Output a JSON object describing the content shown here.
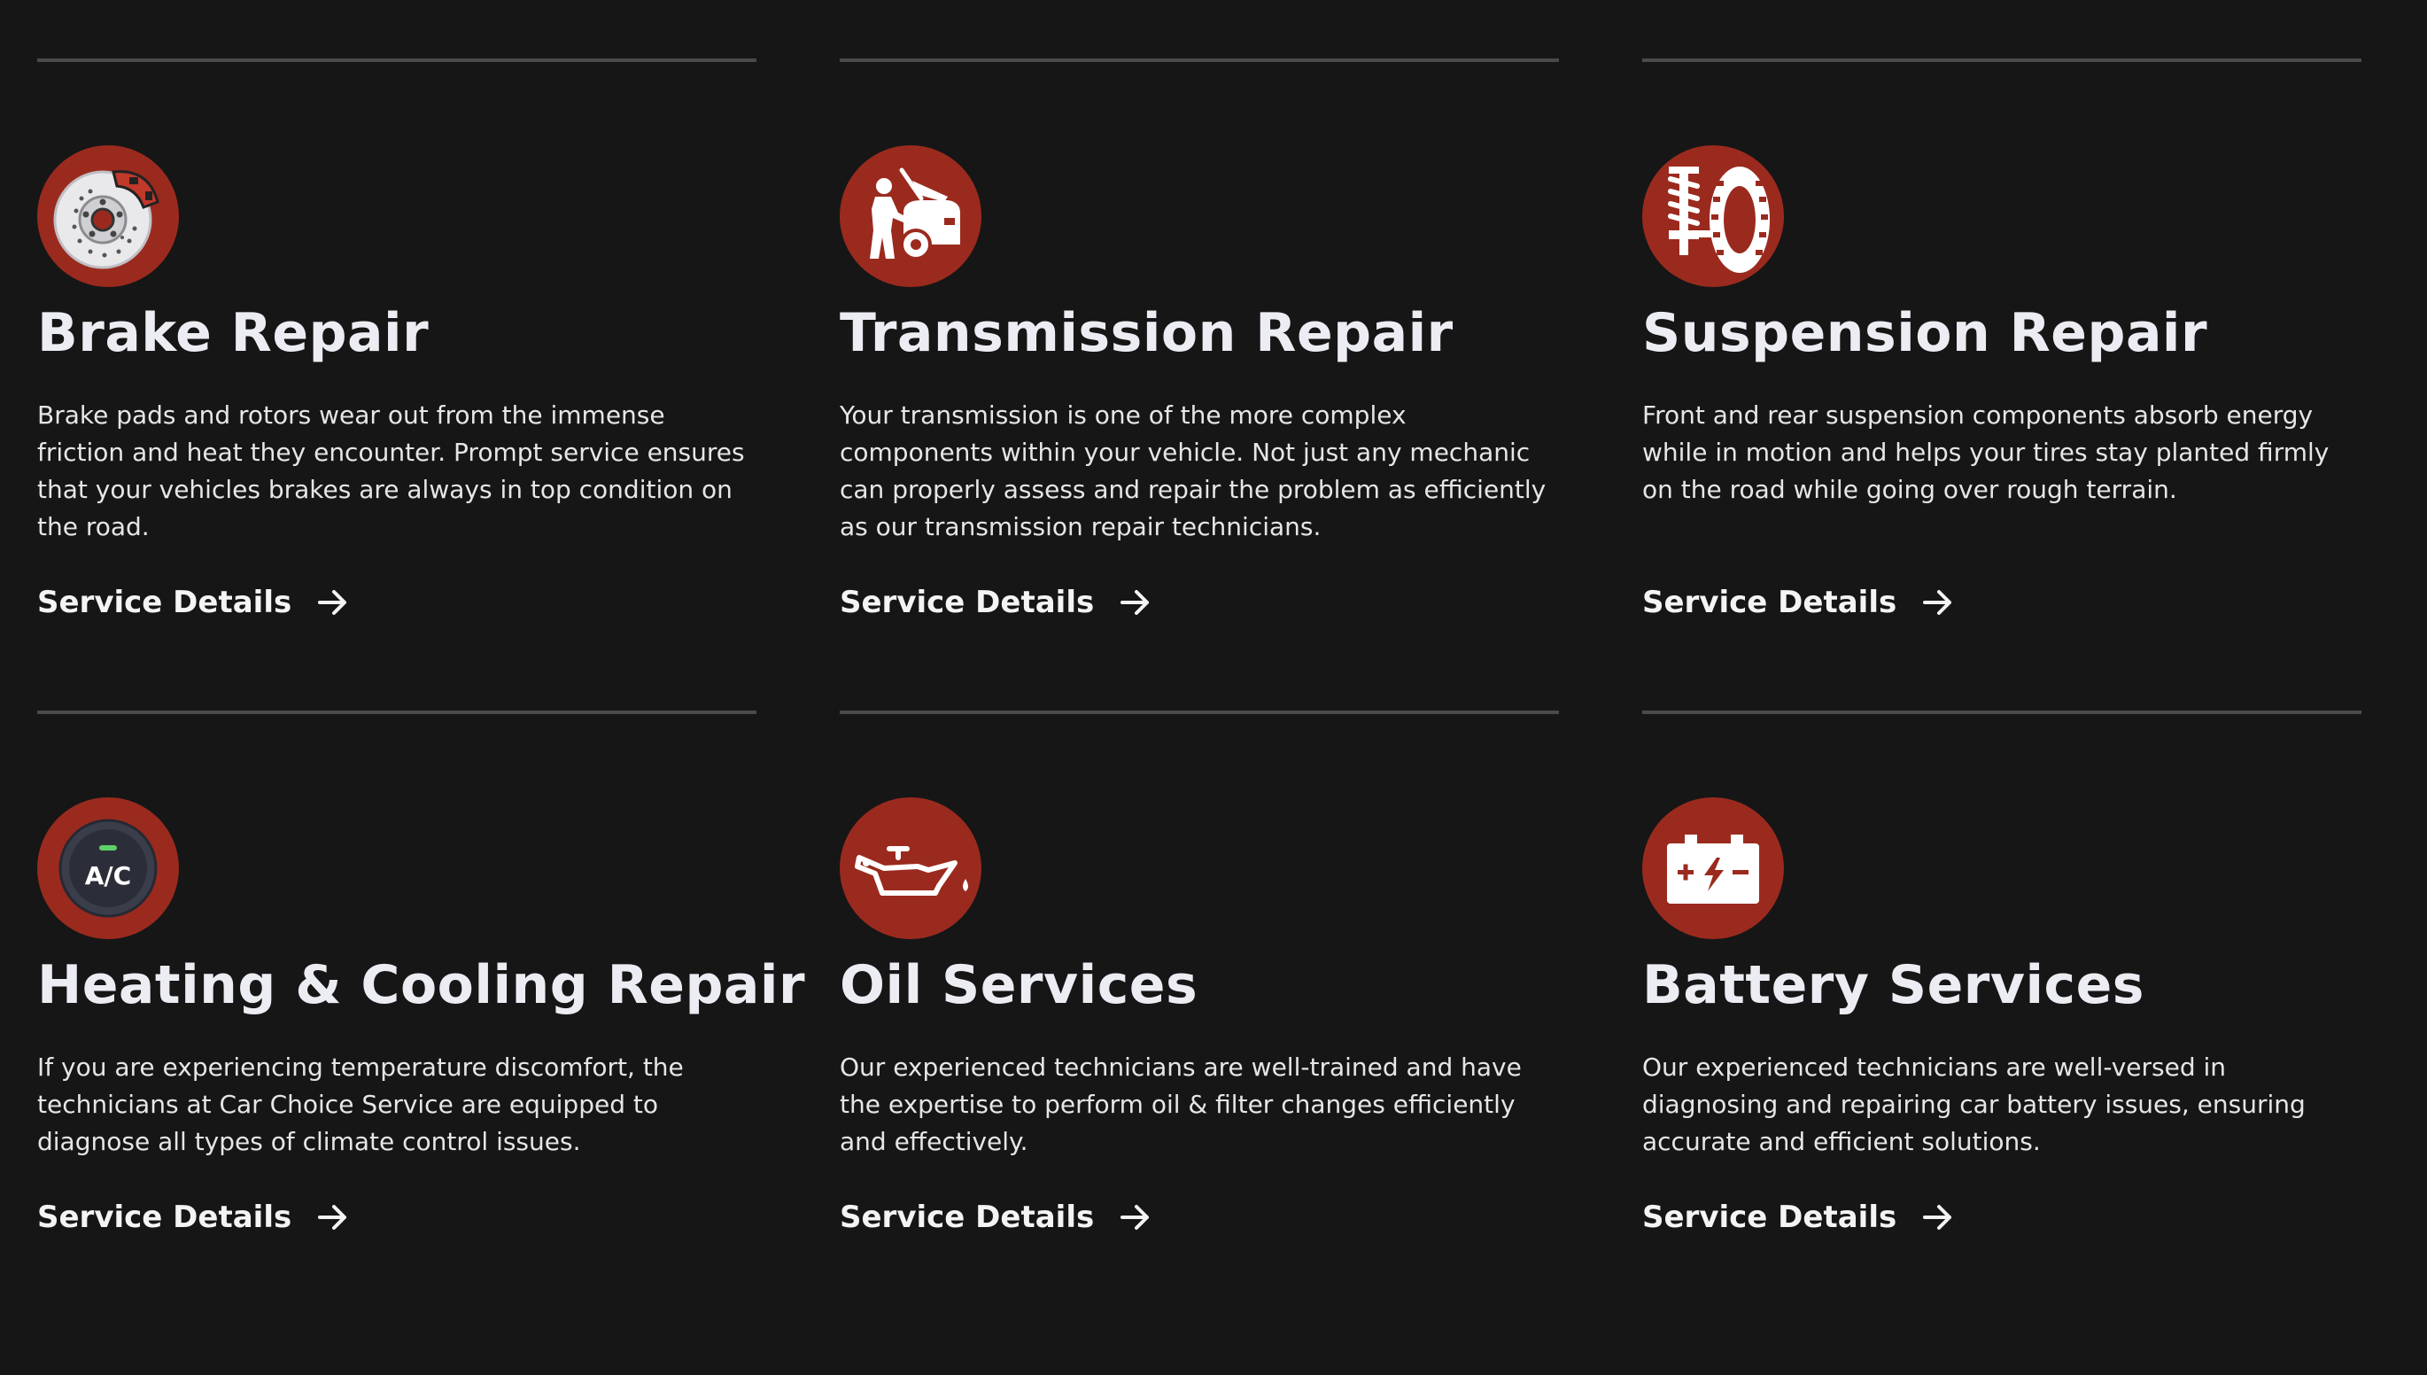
{
  "colors": {
    "background": "#161616",
    "accent": "#9b2a1e",
    "divider": "#4a4a4a",
    "text": "#f2f2f2"
  },
  "services": [
    {
      "icon": "brake-disc-icon",
      "title": "Brake Repair",
      "description": "Brake pads and rotors wear out from the immense friction and heat they encounter. Prompt service ensures that your vehicles brakes are always in top condition on the road.",
      "link_label": "Service Details"
    },
    {
      "icon": "mechanic-car-icon",
      "title": "Transmission Repair",
      "description": "Your transmission is one of the more complex components within your vehicle. Not just any mechanic can properly assess and repair the problem as efficiently as our transmission repair technicians.",
      "link_label": "Service Details"
    },
    {
      "icon": "suspension-tire-icon",
      "title": "Suspension Repair",
      "description": "Front and rear suspension components absorb energy while in motion and helps your tires stay planted firmly on the road while going over rough terrain.",
      "link_label": "Service Details"
    },
    {
      "icon": "ac-button-icon",
      "icon_text": "A/C",
      "title": "Heating & Cooling Repair",
      "description": "If you are experiencing temperature discomfort, the technicians at Car Choice Service are equipped to diagnose all types of climate control issues.",
      "link_label": "Service Details"
    },
    {
      "icon": "oil-can-icon",
      "title": "Oil Services",
      "description": "Our experienced technicians are well-trained and have the expertise to perform oil & filter changes efficiently and effectively.",
      "link_label": "Service Details"
    },
    {
      "icon": "battery-icon",
      "title": "Battery Services",
      "description": "Our experienced technicians are well-versed in diagnosing and repairing car battery issues, ensuring accurate and efficient solutions.",
      "link_label": "Service Details"
    }
  ]
}
